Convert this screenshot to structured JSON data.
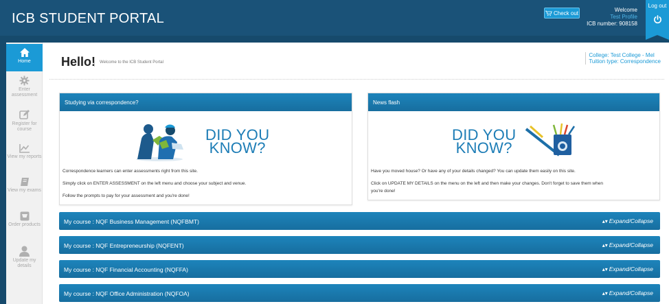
{
  "header": {
    "title": "ICB STUDENT PORTAL",
    "checkout_label": "Check out",
    "welcome_label": "Welcome",
    "user_name": "Test Profile",
    "icb_number": "ICB number: 908158",
    "logout_label": "Log out"
  },
  "sidebar": {
    "items": [
      {
        "label": "Home",
        "icon": "home-icon"
      },
      {
        "label": "Enter assessment",
        "icon": "gear-icon"
      },
      {
        "label": "Register for course",
        "icon": "edit-icon"
      },
      {
        "label": "View my reports",
        "icon": "chart-icon"
      },
      {
        "label": "View my exams",
        "icon": "book-icon"
      },
      {
        "label": "Order products",
        "icon": "cart-icon"
      },
      {
        "label": "Update my details",
        "icon": "user-icon"
      }
    ]
  },
  "main": {
    "hello": "Hello!",
    "hello_sub": "Welcome to the ICB Student Portal",
    "college": "College: Test College - Mel",
    "tuition": "Tuition type: Correspondence"
  },
  "panels": {
    "left": {
      "title": "Studying via correspondence?",
      "dyk_line1": "DID YOU",
      "dyk_line2": "KNOW?",
      "paragraphs": [
        "Correspondence learners can enter assessments right from this site.",
        "Simply click on ENTER ASSESSMENT on the left menu and choose your subject and venue.",
        "Follow the prompts to pay for your assessment and you're done!"
      ]
    },
    "right": {
      "title": "News flash",
      "dyk_line1": "DID YOU",
      "dyk_line2": "KNOW?",
      "paragraphs": [
        "Have you moved house? Or have any of your details changed? You can update them easily on this site.",
        "Click on UPDATE MY DETAILS on the menu on the left and then make your changes. Don't forget to save them when",
        "you're done!"
      ]
    }
  },
  "courses": {
    "toggle_label": "Expand/Collapse",
    "items": [
      "My course : NQF Business Management (NQFBMT)",
      "My course : NQF Entrepreneurship (NQFENT)",
      "My course : NQF Financial Accounting (NQFFA)",
      "My course : NQF Office Administration (NQFOA)"
    ]
  },
  "colors": {
    "header": "#1a5278",
    "accent": "#1b9ad6",
    "panel_head": "#1a7aae"
  }
}
